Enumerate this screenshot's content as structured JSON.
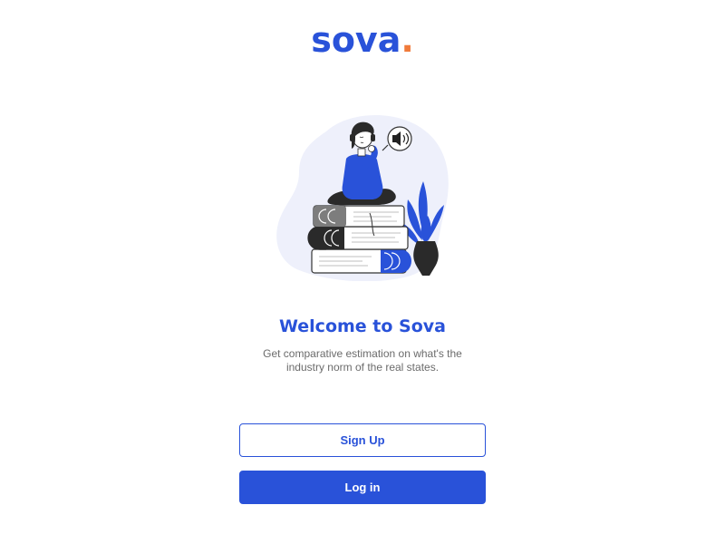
{
  "brand": {
    "name": "sova",
    "dot": ".",
    "primary_color": "#2952d9",
    "accent_color": "#f07a3a"
  },
  "welcome": {
    "title": "Welcome to Sova",
    "subtitle_line1": "Get comparative estimation on what's the",
    "subtitle_line2": "industry norm of the real states."
  },
  "actions": {
    "signup_label": "Sign Up",
    "login_label": "Log in"
  },
  "illustration": {
    "icon": "person-reading-on-books-illustration",
    "speaker_icon": "speaker-icon",
    "plant_icon": "plant-vase-icon"
  }
}
